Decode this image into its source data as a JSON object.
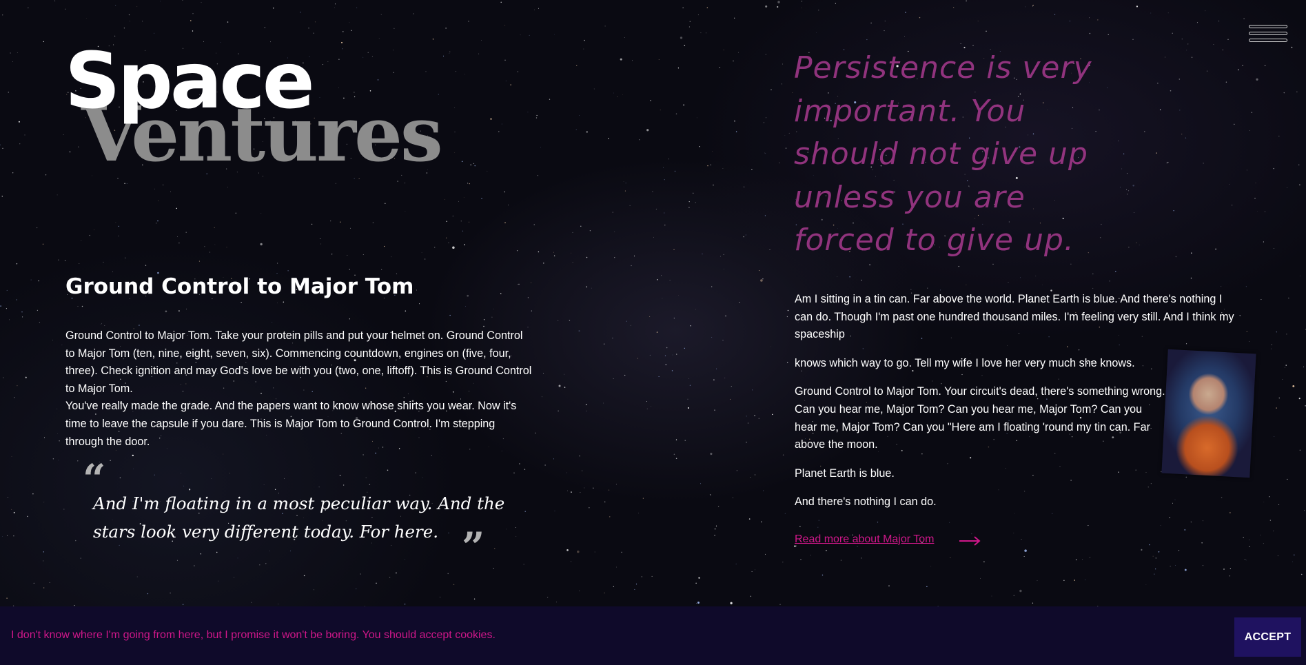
{
  "logo": {
    "line1": "Space",
    "line2": "Ventures"
  },
  "menu": {
    "icon": "hamburger-menu-icon"
  },
  "left": {
    "heading": "Ground Control to Major Tom",
    "paragraphs": [
      "Ground Control to Major Tom. Take your protein pills and put your helmet on. Ground Control to Major Tom (ten, nine, eight, seven, six). Commencing countdown, engines on (five, four, three). Check ignition and may God's love be with you (two, one, liftoff). This is Ground Control to Major Tom.",
      "You've really made the grade. And the papers want to know whose shirts you wear. Now it's time to leave the capsule if you dare. This is Major Tom to Ground Control. I'm stepping through the door."
    ],
    "quote": {
      "open_mark": "“",
      "text": "And I'm floating in a most peculiar way. And the stars look very different today. For here.",
      "close_mark": "”"
    }
  },
  "right": {
    "quote": "Persistence is very important. You should not give up unless you are forced to give up.",
    "paragraphs": [
      "Am I sitting in a tin can. Far above the world. Planet Earth is blue. And there's nothing I can do. Though I'm past one hundred thousand miles. I'm feeling very still. And I think my spaceship",
      "knows which way to go. Tell my wife I love her very much she knows.",
      "Ground Control to Major Tom. Your circuit's dead, there's something wrong. Can you hear me, Major Tom? Can you hear me, Major Tom? Can you hear me, Major Tom? Can you \"Here am I floating 'round my tin can. Far above the moon.",
      "Planet Earth is blue.",
      "And there's nothing I can do."
    ],
    "read_more_label": "Read more about Major Tom",
    "read_more_icon": "arrow-right-icon",
    "image_name": "astronaut-portrait"
  },
  "cookie": {
    "text": "I don't know where I'm going from here, but I promise it won't be boring. You should accept cookies.",
    "accept_label": "ACCEPT"
  },
  "colors": {
    "accent": "#d0178a",
    "quote_color": "#a83a8f",
    "cookie_bg": "#0f0a2a",
    "accept_bg": "#1f1260",
    "logo_secondary": "#8c8c8c",
    "background": "#0a0a12"
  }
}
